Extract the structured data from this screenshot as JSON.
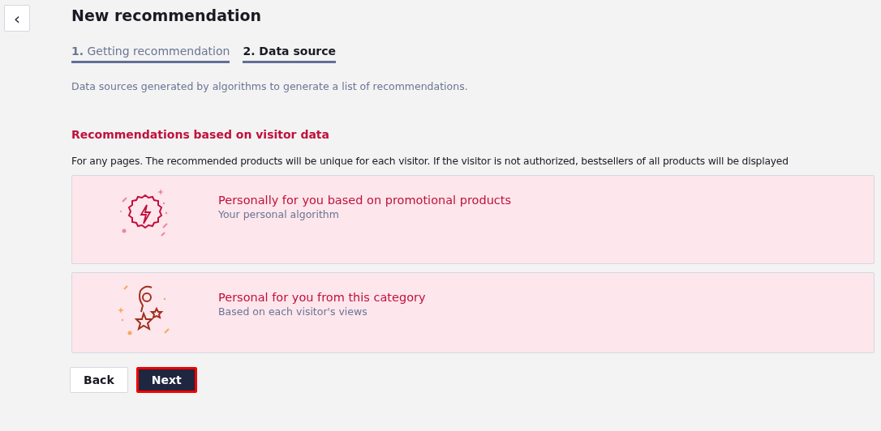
{
  "back_icon_button": {
    "glyph": "‹"
  },
  "title": "New recommendation",
  "tabs": [
    {
      "number": "1.",
      "label": "Getting recommendation",
      "selected": false
    },
    {
      "number": "2.",
      "label": "Data source",
      "selected": true
    }
  ],
  "description": "Data sources generated by algorithms to generate a list of recommendations.",
  "section": {
    "title": "Recommendations based on visitor data",
    "text": "For any pages. The recommended products will be unique for each visitor. If the visitor is not authorized, bestsellers of all products will be displayed"
  },
  "options": [
    {
      "kind": "promo",
      "title": "Personally for you based on promotional products",
      "subtitle": "Your personal algorithm"
    },
    {
      "kind": "category",
      "title": "Personal for you from this category",
      "subtitle": "Based on each visitor's views"
    }
  ],
  "buttons": {
    "back": "Back",
    "next": "Next"
  }
}
